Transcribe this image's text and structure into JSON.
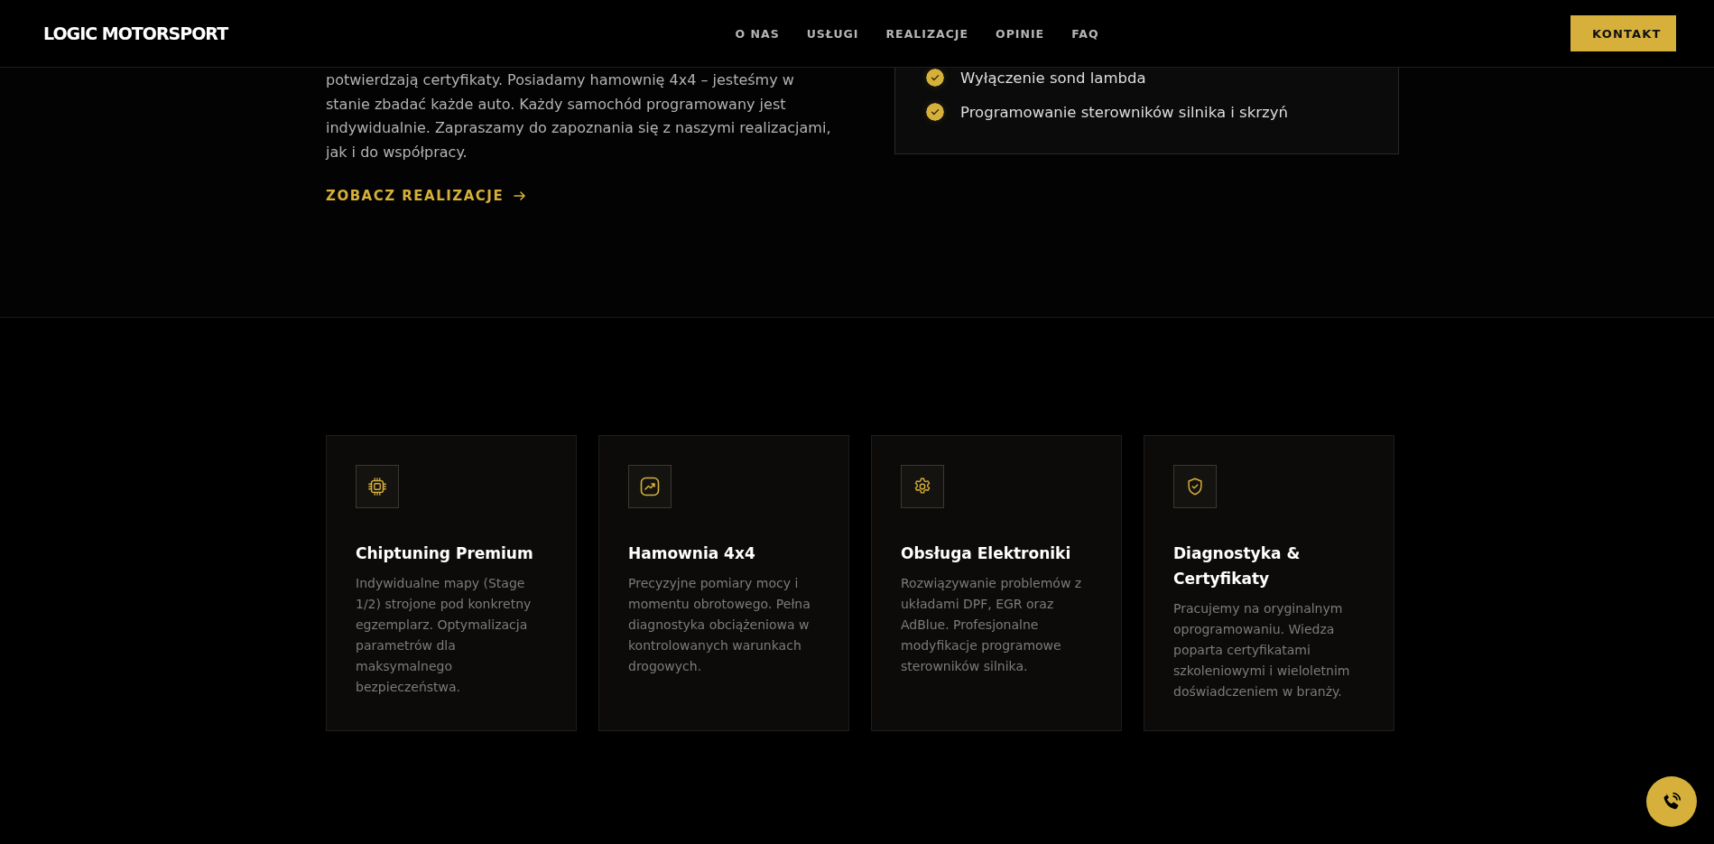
{
  "header": {
    "logo": "LOGIC MOTORSPORT",
    "nav": [
      "O NAS",
      "USŁUGI",
      "REALIZACJE",
      "OPINIE",
      "FAQ"
    ],
    "cta": "KONTAKT"
  },
  "intro": {
    "text_lines": [
      "potwierdzają certyfikaty. Posiadamy hamownię 4x4 – jesteśmy w",
      "stanie zbadać każde auto. Każdy samochód programowany jest",
      "indywidualnie. Zapraszamy do zapoznania się z naszymi realizacjami,",
      "jak i do współpracy."
    ],
    "link": "ZOBACZ REALIZACJE"
  },
  "features": [
    {
      "label": "Wyłączenie sond lambda"
    },
    {
      "label": "Programowanie sterowników silnika i skrzyń"
    }
  ],
  "services": [
    {
      "title": "Chiptuning Premium",
      "description": "Indywidualne mapy (Stage 1/2) strojone pod konkretny egzemplarz. Optymalizacja parametrów dla maksymalnego bezpieczeństwa."
    },
    {
      "title": "Hamownia 4x4",
      "description": "Precyzyjne pomiary mocy i momentu obrotowego. Pełna diagnostyka obciążeniowa w kontrolowanych warunkach drogowych."
    },
    {
      "title": "Obsługa Elektroniki",
      "description": "Rozwiązywanie problemów z układami DPF, EGR oraz AdBlue. Profesjonalne modyfikacje programowe sterowników silnika."
    },
    {
      "title": "Diagnostyka & Certyfikaty",
      "description": "Pracujemy na oryginalnym oprogramowaniu. Wiedza poparta certyfikatami szkoleniowymi i wieloletnim doświadczeniem w branży."
    }
  ]
}
